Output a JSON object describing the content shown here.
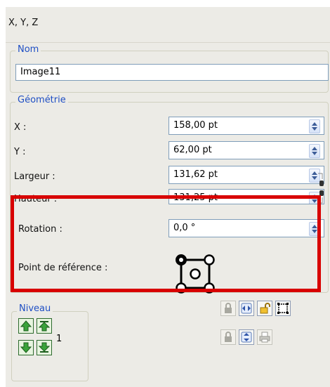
{
  "header": {
    "title": "X, Y, Z"
  },
  "name_group": {
    "legend": "Nom",
    "value": "Image11"
  },
  "geometry": {
    "legend": "Géométrie",
    "rows": [
      {
        "label": "X :",
        "value": "158,00 pt"
      },
      {
        "label": "Y :",
        "value": "62,00 pt"
      },
      {
        "label": "Largeur :",
        "value": "131,62 pt"
      },
      {
        "label": "Hauteur :",
        "value": "131,25 pt"
      },
      {
        "label": "Rotation :",
        "value": "0,0 °"
      }
    ],
    "reference_point": {
      "label": "Point de référence :"
    }
  },
  "level": {
    "legend": "Niveau",
    "value": "1"
  },
  "colors": {
    "legend": "#1f4fc4",
    "highlight": "#d80000",
    "panel": "#ecebe6"
  },
  "icons": [
    "raise-to-top-icon",
    "raise-icon",
    "lower-icon",
    "lower-to-bottom-icon",
    "lock-icon",
    "flip-horizontal-icon",
    "flip-vertical-icon",
    "fit-frame-icon",
    "unlock-icon"
  ]
}
